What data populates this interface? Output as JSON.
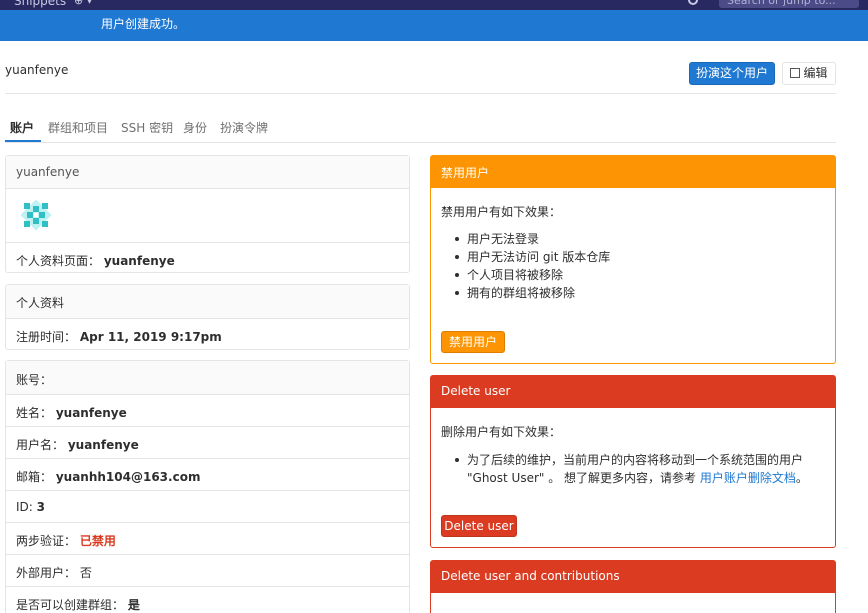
{
  "topbar": {
    "nav_item": "Snippets",
    "search_placeholder": "Search or jump to..."
  },
  "flash": {
    "message": "用户创建成功。"
  },
  "header": {
    "username": "yuanfenye",
    "impersonate_label": "扮演这个用户",
    "edit_label": "编辑"
  },
  "tabs": [
    {
      "label": "账户"
    },
    {
      "label": "群组和项目"
    },
    {
      "label": "SSH 密钥"
    },
    {
      "label": "身份"
    },
    {
      "label": "扮演令牌"
    }
  ],
  "profile_card": {
    "title": "yuanfenye",
    "profile_page_label": "个人资料页面：",
    "profile_page_value": "yuanfenye"
  },
  "personal_card": {
    "title": "个人资料",
    "registered_label": "注册时间：",
    "registered_value": "Apr 11, 2019 9:17pm"
  },
  "account_card": {
    "title": "账号：",
    "name_label": "姓名：",
    "name_value": "yuanfenye",
    "username_label": "用户名：",
    "username_value": "yuanfenye",
    "email_label": "邮箱：",
    "email_value": "yuanhh104@163.com",
    "id_label": "ID:",
    "id_value": "3",
    "twofa_label": "两步验证：",
    "twofa_value": "已禁用",
    "external_label": "外部用户：",
    "external_value": "否",
    "can_create_group_label": "是否可以创建群组：",
    "can_create_group_value": "是"
  },
  "block_panel": {
    "title": "禁用用户",
    "intro": "禁用用户有如下效果：",
    "effects": [
      "用户无法登录",
      "用户无法访问 git 版本仓库",
      "个人项目将被移除",
      "拥有的群组将被移除"
    ],
    "button_label": "禁用用户"
  },
  "delete_panel": {
    "title": "Delete user",
    "intro": "删除用户有如下效果：",
    "effect_line1": "为了后续的维护，当前用户的内容将移动到一个系统范围的用户",
    "effect_line2": "\"Ghost User\" 。 想了解更多内容，请参考",
    "doc_link": "用户账户删除文档",
    "period": "。",
    "button_label": "Delete user"
  },
  "delete_contrib_panel": {
    "title": "Delete user and contributions"
  },
  "colors": {
    "topbar": "#292961",
    "flash": "#1f78d1",
    "primary": "#1f78d1",
    "warning": "#fc9403",
    "danger": "#db3b21"
  }
}
